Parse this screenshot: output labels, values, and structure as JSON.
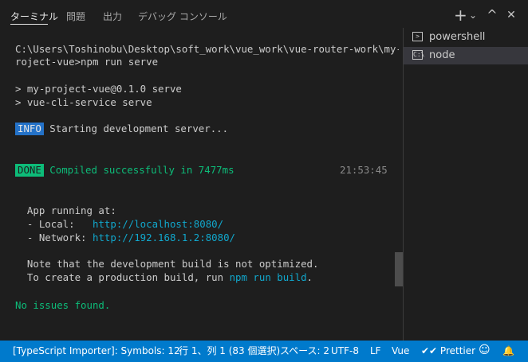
{
  "panel": {
    "tabs": [
      {
        "label": "ターミナル",
        "active": true
      },
      {
        "label": "問題"
      },
      {
        "label": "出力"
      },
      {
        "label": "デバッグ コンソール"
      }
    ],
    "actions": {
      "add": "+",
      "dropdown": "⌄",
      "maximize": "^",
      "close": "✕"
    }
  },
  "terminal": {
    "prompt1": "C:\\Users\\Toshinobu\\Desktop\\soft_work\\vue_work\\vue-router-work\\my-p",
    "prompt2": "roject-vue>npm run serve",
    "script1": "> my-project-vue@0.1.0 serve",
    "script2": "> vue-cli-service serve",
    "info_badge": "INFO",
    "info_text": " Starting development server...",
    "done_badge": "DONE",
    "done_text": " Compiled successfully in 7477ms",
    "done_time": "21:53:45",
    "app_running": "  App running at:",
    "local_label": "  - Local:   ",
    "local_url": "http://localhost:8080/",
    "network_label": "  - Network: ",
    "network_url": "http://192.168.1.2:8080/",
    "note1": "  Note that the development build is not optimized.",
    "note2_pre": "  To create a production build, run ",
    "note2_cmd": "npm run build",
    "note2_post": ".",
    "no_issues": "No issues found."
  },
  "sessions": [
    {
      "label": "powershell",
      "icon": "chevron-right-icon"
    },
    {
      "label": "node",
      "icon": "terminal-icon",
      "selected": true
    }
  ],
  "statusbar": {
    "ts_importer": "[TypeScript Importer]: Symbols: 12",
    "position": "行 1、列 1 (83 個選択)",
    "spaces": "スペース: 2",
    "encoding": "UTF-8",
    "eol": "LF",
    "language": "Vue",
    "prettier": "✔✔ Prettier",
    "feedback": "☺",
    "bell": "🔔"
  },
  "colors": {
    "background": "#1e1e1e",
    "statusbar": "#007acc",
    "info": "#2472c8",
    "done": "#0dbc79",
    "link": "#11a8cd"
  }
}
